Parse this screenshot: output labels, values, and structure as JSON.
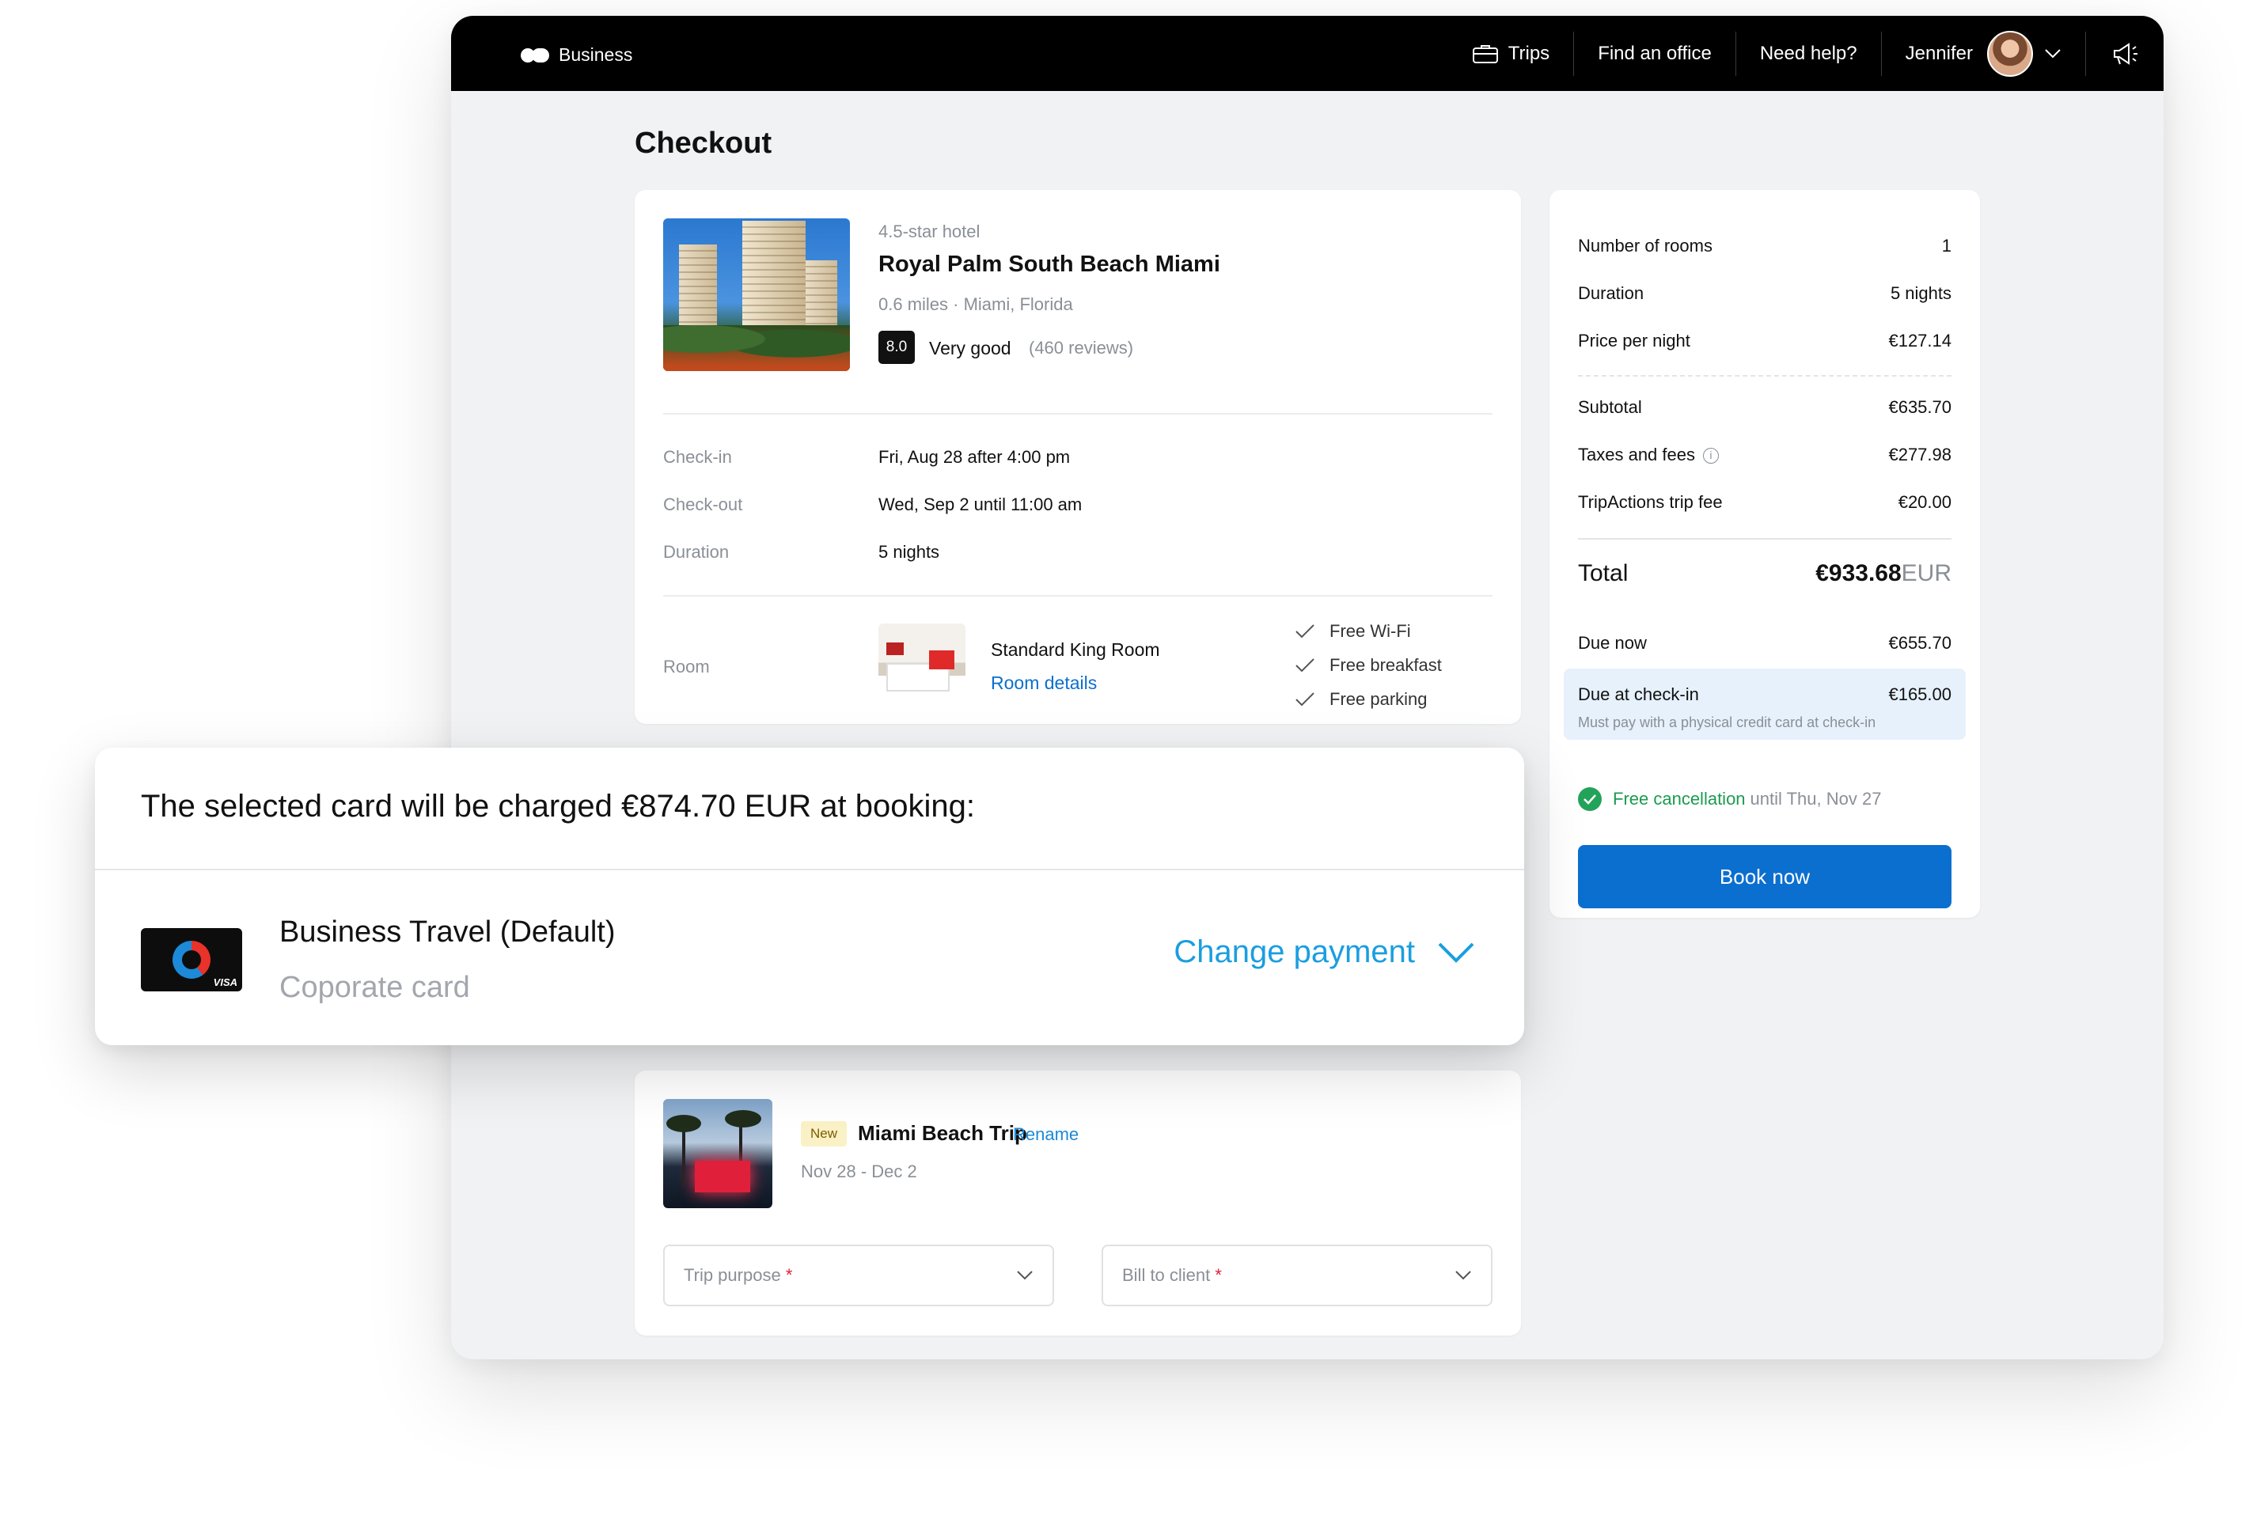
{
  "app": {
    "brand": "Business"
  },
  "nav": {
    "trips": "Trips",
    "find_office": "Find an office",
    "help": "Need help?",
    "user": "Jennifer"
  },
  "page": {
    "title": "Checkout"
  },
  "hotel": {
    "stars": "4.5-star hotel",
    "name": "Royal Palm South Beach Miami",
    "distance_location": "0.6 miles · Miami, Florida",
    "rating": "8.0",
    "rating_label": "Very good",
    "reviews": "(460 reviews)"
  },
  "stay": {
    "checkin_label": "Check-in",
    "checkin_value": "Fri, Aug 28 after 4:00 pm",
    "checkout_label": "Check-out",
    "checkout_value": "Wed, Sep 2 until 11:00 am",
    "duration_label": "Duration",
    "duration_value": "5 nights"
  },
  "room": {
    "label": "Room",
    "name": "Standard King Room",
    "details_link": "Room details",
    "amenities": [
      "Free Wi-Fi",
      "Free breakfast",
      "Free parking"
    ]
  },
  "summary": {
    "rooms_label": "Number of rooms",
    "rooms_value": "1",
    "duration_label": "Duration",
    "duration_value": "5 nights",
    "ppn_label": "Price per night",
    "ppn_value": "€127.14",
    "subtotal_label": "Subtotal",
    "subtotal_value": "€635.70",
    "taxes_label": "Taxes and fees",
    "taxes_value": "€277.98",
    "trip_fee_label": "TripActions trip fee",
    "trip_fee_value": "€20.00",
    "total_label": "Total",
    "total_value": "€933.68",
    "total_currency": "EUR",
    "due_now_label": "Due now",
    "due_now_value": "€655.70",
    "due_checkin_label": "Due at check-in",
    "due_checkin_value": "€165.00",
    "due_checkin_note": "Must pay with a physical credit card at check-in",
    "free_cancel": "Free cancellation",
    "free_cancel_until": "until Thu, Nov 27",
    "book_button": "Book now"
  },
  "payment": {
    "heading": "The selected card will be charged €874.70 EUR at booking:",
    "card_name": "Business Travel (Default)",
    "card_type": "Coporate card",
    "card_brand": "VISA",
    "change_button": "Change payment"
  },
  "trip": {
    "badge": "New",
    "name": "Miami Beach Trip",
    "rename": "Rename",
    "dates": "Nov 28 - Dec 2",
    "purpose_placeholder": "Trip purpose",
    "bill_placeholder": "Bill to client",
    "required_mark": "*"
  },
  "colors": {
    "primary": "#0b6fcf",
    "accent_link": "#1a9ee0",
    "success": "#23a35a",
    "topbar": "#000000"
  }
}
